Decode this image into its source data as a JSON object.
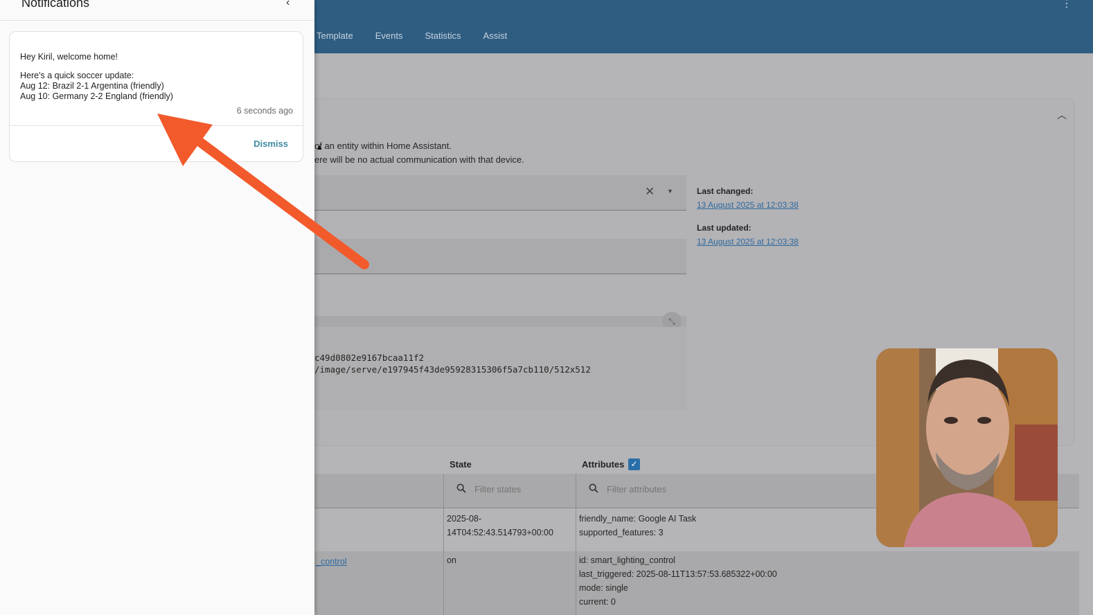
{
  "header": {
    "tabs": [
      "Template",
      "Events",
      "Statistics",
      "Assist"
    ]
  },
  "card": {
    "desc_line1": "of an entity within Home Assistant.",
    "desc_line2": "ere will be no actual communication with that device.",
    "last_changed_label": "Last changed:",
    "last_changed_value": "13 August 2025 at 12:03:38",
    "last_updated_label": "Last updated:",
    "last_updated_value": "13 August 2025 at 12:03:38",
    "yaml_line1": "c49d0802e9167bcaa11f2",
    "yaml_line2": "/image/serve/e197945f43de95928315306f5a7cb110/512x512"
  },
  "table": {
    "col_state": "State",
    "col_attributes": "Attributes",
    "filter_states_placeholder": "Filter states",
    "filter_attributes_placeholder": "Filter attributes",
    "rows": [
      {
        "entity": "",
        "state_line1": "2025-08-",
        "state_line2": "14T04:52:43.514793+00:00",
        "attr_line1": "friendly_name: Google AI Task",
        "attr_line2": "supported_features: 3"
      },
      {
        "entity": "_control",
        "state_line1": "on",
        "attr_line1": "id: smart_lighting_control",
        "attr_line2": "last_triggered: 2025-08-11T13:57:53.685322+00:00",
        "attr_line3": "mode: single",
        "attr_line4": "current: 0"
      }
    ]
  },
  "notifications": {
    "title": "Notifications",
    "items": [
      {
        "greeting": "Hey Kiril, welcome home!",
        "line1": "Here's a quick soccer update:",
        "line2": "Aug 12: Brazil 2-1 Argentina (friendly)",
        "line3": "Aug 10: Germany 2-2 England (friendly)",
        "time": "6 seconds ago",
        "dismiss_label": "Dismiss"
      }
    ]
  },
  "colors": {
    "header_bg": "#2f5d82",
    "arrow": "#f25a2c",
    "dismiss_link": "#3f8aa3"
  }
}
